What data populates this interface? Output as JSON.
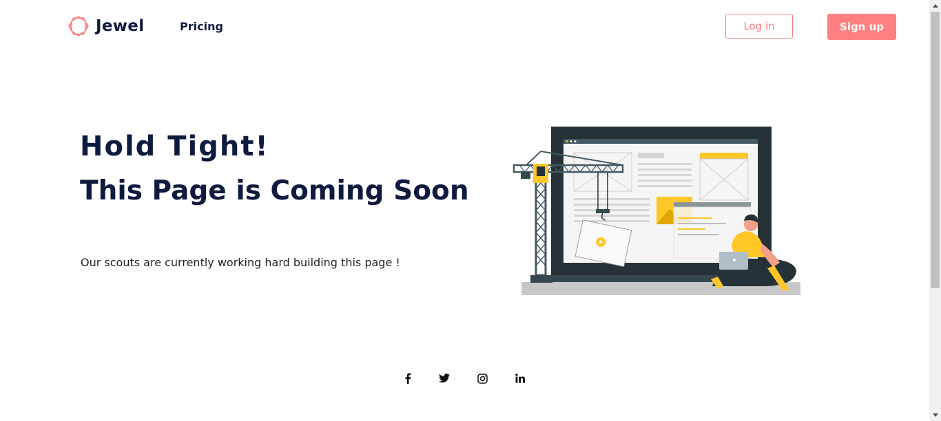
{
  "header": {
    "brand": "Jewel",
    "nav_pricing": "Pricing",
    "login_label": "Log in",
    "signup_label": "Sign up"
  },
  "hero": {
    "title_line1": "Hold Tight!",
    "title_line2": "This Page is Coming Soon",
    "subtitle": "Our scouts are currently working hard building this page !"
  },
  "footer": {
    "social": [
      "facebook-icon",
      "twitter-icon",
      "instagram-icon",
      "linkedin-icon"
    ]
  },
  "colors": {
    "accent": "#ff8080",
    "heading": "#0e1a3f",
    "illustration_yellow": "#ffc727",
    "illustration_dark": "#263238"
  }
}
